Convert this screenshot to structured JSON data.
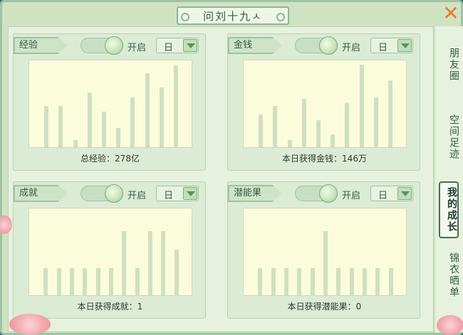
{
  "window": {
    "title": "问刘十九ㅅ"
  },
  "tabs": [
    {
      "label": "朋友圈",
      "active": false
    },
    {
      "label": "空间足迹",
      "active": false
    },
    {
      "label": "我的成长",
      "active": true
    },
    {
      "label": "锦衣晒单",
      "active": false
    }
  ],
  "panels": [
    {
      "tag": "经验",
      "toggle_label": "开启",
      "period": "日",
      "footer": "总经验：278亿",
      "chart_data": {
        "type": "bar",
        "values": [
          58,
          58,
          10,
          77,
          50,
          27,
          70,
          104,
          84,
          115
        ],
        "ylim": [
          0,
          124
        ]
      }
    },
    {
      "tag": "金钱",
      "toggle_label": "开启",
      "period": "日",
      "footer": "本日获得金钱：146万",
      "chart_data": {
        "type": "bar",
        "values": [
          46,
          58,
          10,
          68,
          38,
          18,
          62,
          116,
          70,
          94
        ],
        "ylim": [
          0,
          124
        ]
      }
    },
    {
      "tag": "成就",
      "toggle_label": "开启",
      "period": "日",
      "footer": "本日获得成就：1",
      "chart_data": {
        "type": "bar",
        "values": [
          38,
          38,
          38,
          38,
          38,
          38,
          90,
          38,
          90,
          90,
          64
        ],
        "ylim": [
          0,
          124
        ]
      }
    },
    {
      "tag": "潜能果",
      "toggle_label": "开启",
      "period": "日",
      "footer": "本日获得潜能果：0",
      "chart_data": {
        "type": "bar",
        "values": [
          38,
          38,
          38,
          38,
          38,
          90,
          38,
          38,
          38,
          38,
          38
        ],
        "ylim": [
          0,
          124
        ]
      }
    }
  ]
}
